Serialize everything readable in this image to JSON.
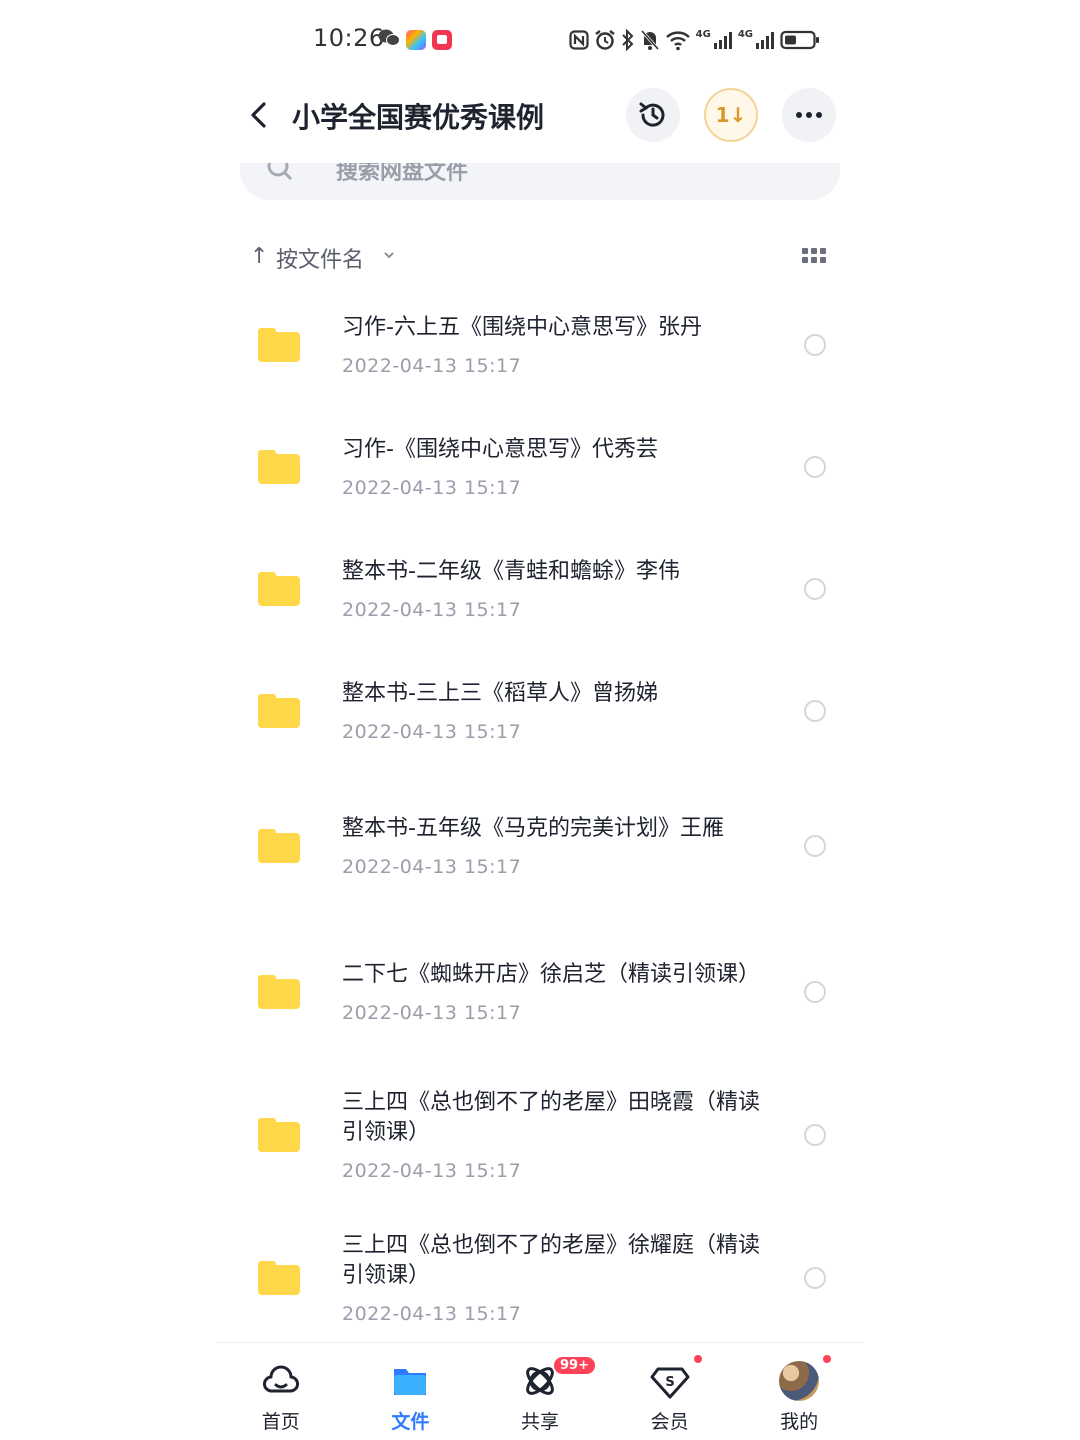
{
  "status_bar": {
    "time": "10:26",
    "net1": "4G",
    "net2": "4G"
  },
  "header": {
    "title": "小学全国赛优秀课例",
    "transfer_label": "1↓"
  },
  "search": {
    "placeholder": "搜索网盘文件"
  },
  "sort": {
    "arrow": "↑",
    "label": "按文件名"
  },
  "files": [
    {
      "name": "习作-六上五《围绕中心意思写》张丹",
      "date": "2022-04-13  15:17"
    },
    {
      "name": "习作-《围绕中心意思写》代秀芸",
      "date": "2022-04-13  15:17"
    },
    {
      "name": "整本书-二年级《青蛙和蟾蜍》李伟",
      "date": "2022-04-13  15:17"
    },
    {
      "name": "整本书-三上三《稻草人》曾扬娣",
      "date": "2022-04-13  15:17"
    },
    {
      "name": "整本书-五年级《马克的完美计划》王雁",
      "date": "2022-04-13  15:17"
    },
    {
      "name": "二下七《蜘蛛开店》徐启芝（精读引领课）",
      "date": "2022-04-13  15:17"
    },
    {
      "name": "三上四《总也倒不了的老屋》田晓霞（精读引领课）",
      "date": "2022-04-13  15:17"
    },
    {
      "name": "三上四《总也倒不了的老屋》徐耀庭（精读引领课）",
      "date": "2022-04-13  15:17"
    }
  ],
  "tabs": {
    "home": "首页",
    "files": "文件",
    "share": "共享",
    "share_badge": "99+",
    "vip": "会员",
    "me": "我的"
  },
  "colors": {
    "accent": "#2f7bff",
    "folder": "#ffd84a",
    "badge": "#ff4257"
  }
}
